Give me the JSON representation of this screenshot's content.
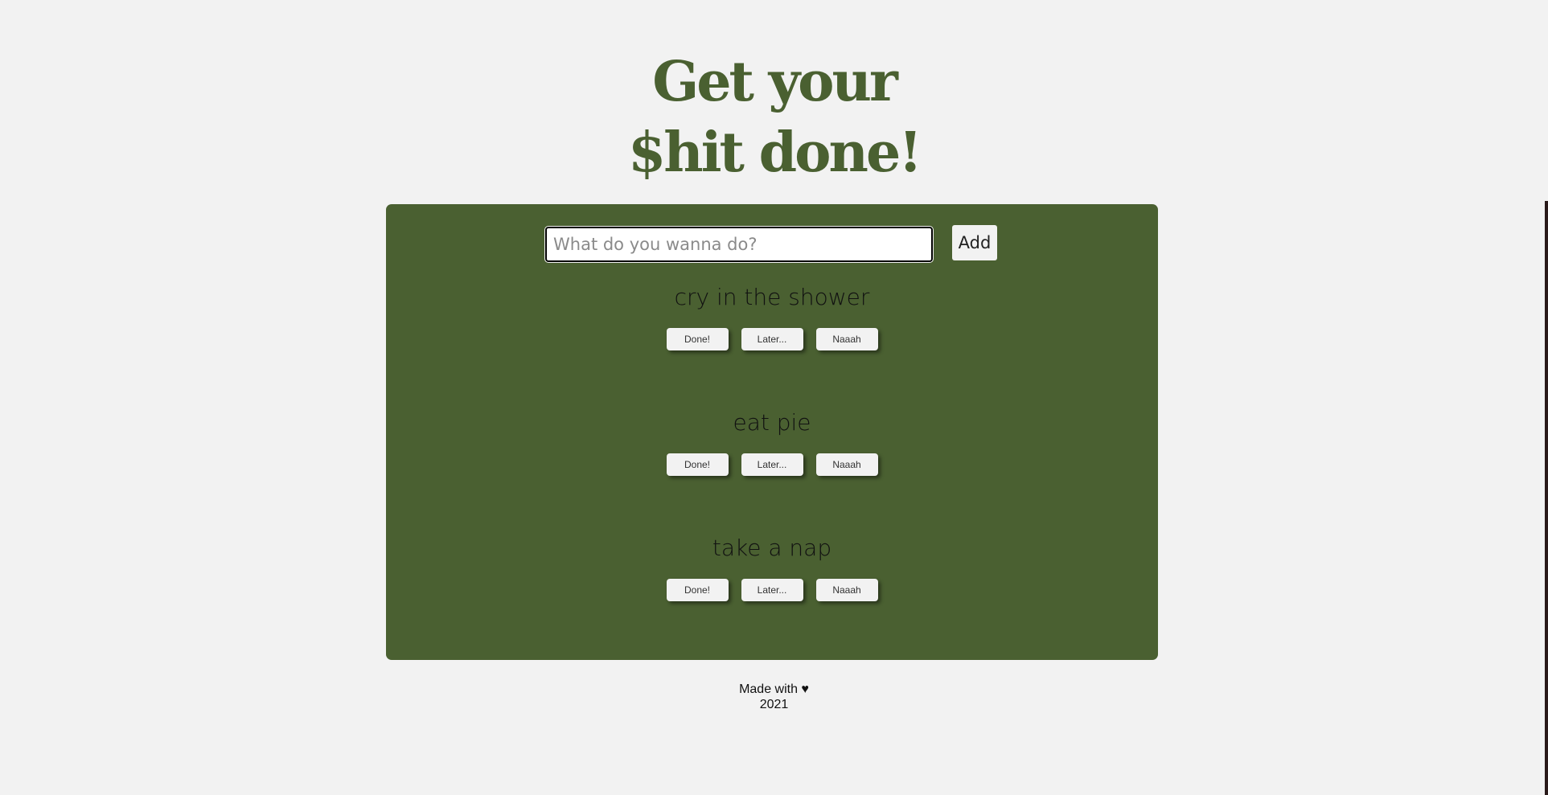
{
  "header": {
    "title_line1": "Get your",
    "title_line2": "$hit done!"
  },
  "form": {
    "input_value": "",
    "input_placeholder": "What do you wanna do?",
    "add_label": "Add"
  },
  "tasks": [
    {
      "title": "cry in the shower",
      "done_label": "Done!",
      "later_label": "Later...",
      "nah_label": "Naaah"
    },
    {
      "title": "eat pie",
      "done_label": "Done!",
      "later_label": "Later...",
      "nah_label": "Naaah"
    },
    {
      "title": "take a nap",
      "done_label": "Done!",
      "later_label": "Later...",
      "nah_label": "Naaah"
    }
  ],
  "footer": {
    "made_with": "Made with ♥",
    "year": "2021"
  },
  "colors": {
    "accent": "#4a6031",
    "background": "#f2f2f2"
  }
}
